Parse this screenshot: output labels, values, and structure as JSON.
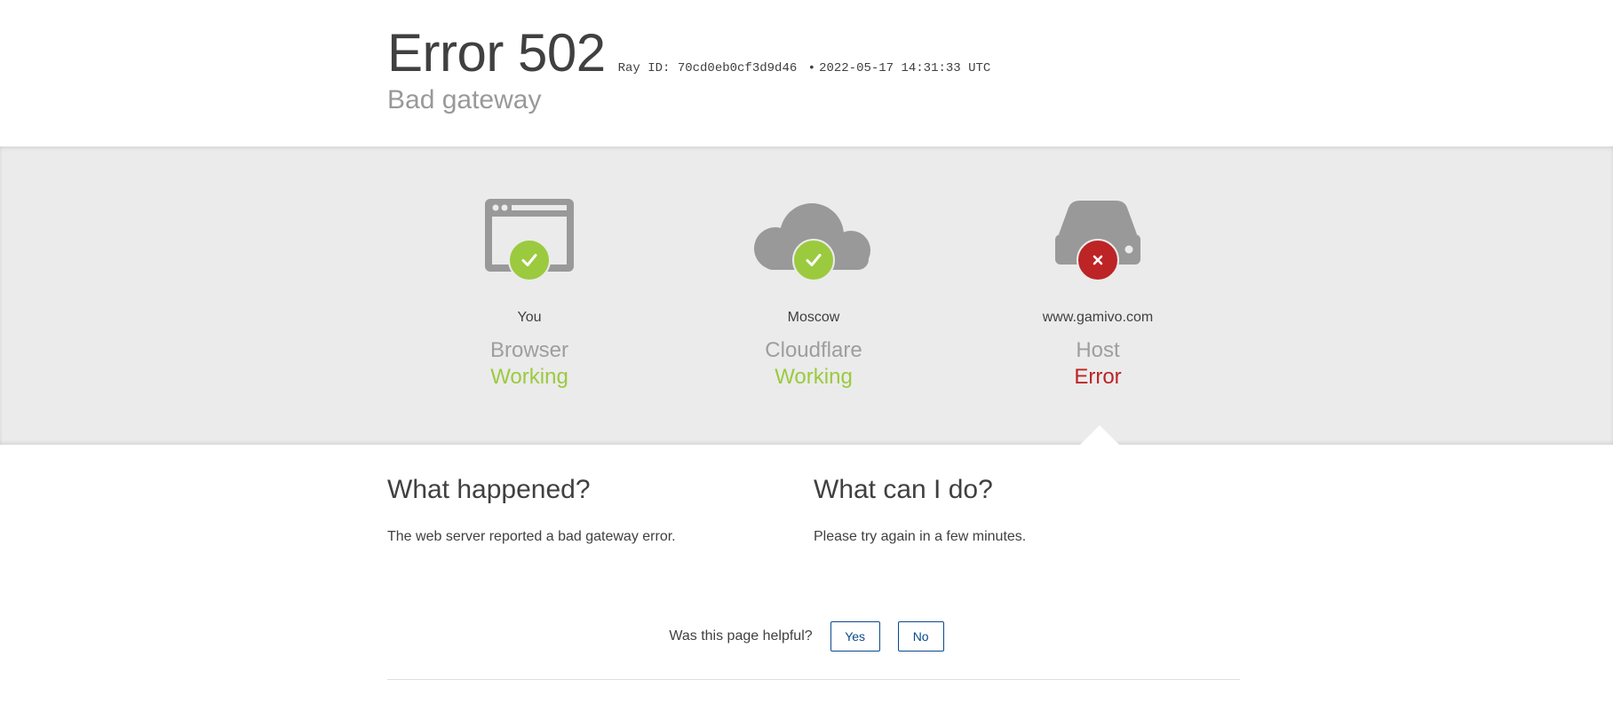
{
  "header": {
    "error_code": "Error 502",
    "ray_id": "Ray ID: 70cd0eb0cf3d9d46",
    "separator": "•",
    "timestamp": "2022-05-17 14:31:33 UTC",
    "subtitle": "Bad gateway"
  },
  "nodes": [
    {
      "location": "You",
      "role": "Browser",
      "state": "Working",
      "status": "ok",
      "icon": "browser-icon"
    },
    {
      "location": "Moscow",
      "role": "Cloudflare",
      "state": "Working",
      "status": "ok",
      "icon": "cloud-icon"
    },
    {
      "location": "www.gamivo.com",
      "role": "Host",
      "state": "Error",
      "status": "error",
      "icon": "server-icon"
    }
  ],
  "sections": {
    "what_happened": {
      "title": "What happened?",
      "body": "The web server reported a bad gateway error."
    },
    "what_can_i_do": {
      "title": "What can I do?",
      "body": "Please try again in a few minutes."
    }
  },
  "feedback": {
    "question": "Was this page helpful?",
    "yes_label": "Yes",
    "no_label": "No"
  },
  "colors": {
    "ok": "#9bca3e",
    "error": "#bd2426",
    "icon_gray": "#999999",
    "band_bg": "#ebebeb",
    "button": "#0a4a8a"
  }
}
